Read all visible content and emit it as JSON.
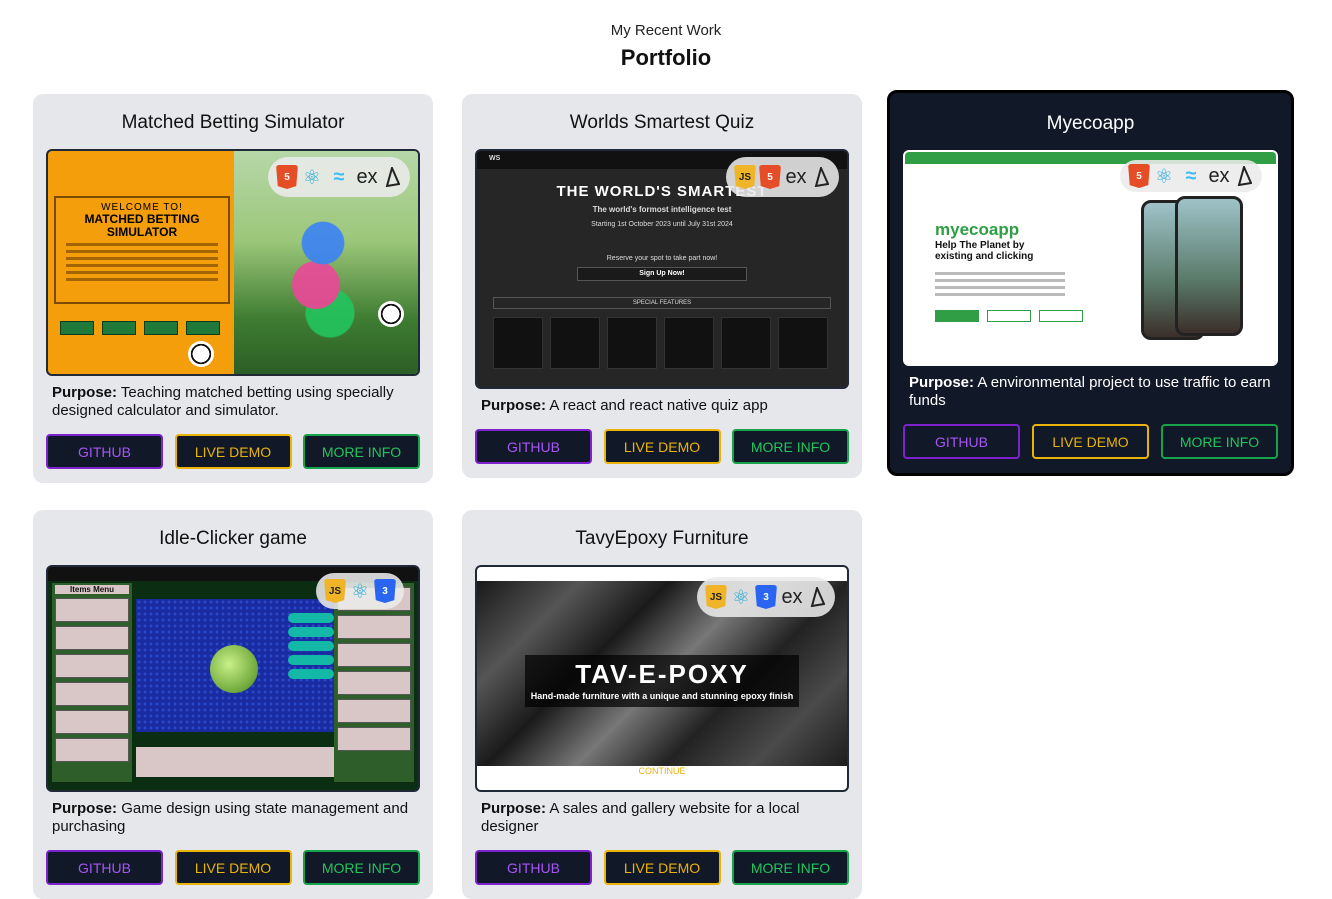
{
  "header": {
    "subtitle": "My Recent Work",
    "title": "Portfolio"
  },
  "colors": {
    "github": "#a855f7",
    "live_demo": "#eab308",
    "more_info": "#22c55e",
    "card_bg": "#e5e7eb",
    "card_dark_bg": "#111827"
  },
  "cards": [
    {
      "title": "Matched Betting Simulator",
      "purpose_label": "Purpose:",
      "purpose": "Teaching matched betting using specially designed calculator and simulator.",
      "tech_icons": [
        "html5-icon",
        "react-icon",
        "tailwind-icon",
        "express-icon",
        "prisma-icon"
      ],
      "shot": {
        "welcome": "WELCOME TO!",
        "name": "MATCHED BETTING SIMULATOR"
      },
      "github": "GITHUB",
      "live_demo": "LIVE DEMO",
      "more_info": "MORE INFO"
    },
    {
      "title": "Worlds Smartest Quiz",
      "purpose_label": "Purpose:",
      "purpose": "A react and react native quiz app",
      "tech_icons": [
        "javascript-icon",
        "html5-icon",
        "express-icon",
        "prisma-icon"
      ],
      "shot": {
        "logo": "WS",
        "headline": "THE WORLD'S SMARTEST",
        "line1": "The world's formost intelligence test",
        "line2": "Starting 1st October 2023 until July 31st 2024",
        "line3": "Reserve your spot to take part now!",
        "signup": "Sign Up Now!",
        "features": "SPECIAL FEATURES"
      },
      "github": "GITHUB",
      "live_demo": "LIVE DEMO",
      "more_info": "MORE INFO"
    },
    {
      "title": "Myecoapp",
      "purpose_label": "Purpose:",
      "purpose": "A environmental project to use traffic to earn funds",
      "tech_icons": [
        "html5-icon",
        "react-icon",
        "tailwind-icon",
        "express-icon",
        "prisma-icon"
      ],
      "shot": {
        "brand": "myecoapp",
        "tagline": "Help The Planet by existing and clicking"
      },
      "github": "GITHUB",
      "live_demo": "LIVE DEMO",
      "more_info": "MORE INFO"
    },
    {
      "title": "Idle-Clicker game",
      "purpose_label": "Purpose:",
      "purpose": "Game design using state management and purchasing",
      "tech_icons": [
        "javascript-icon",
        "react-icon",
        "css3-icon"
      ],
      "shot": {
        "menu": "Items Menu"
      },
      "github": "GITHUB",
      "live_demo": "LIVE DEMO",
      "more_info": "MORE INFO"
    },
    {
      "title": "TavyEpoxy Furniture",
      "purpose_label": "Purpose:",
      "purpose": "A sales and gallery website for a local designer",
      "tech_icons": [
        "javascript-icon",
        "react-icon",
        "css3-icon",
        "express-icon",
        "prisma-icon"
      ],
      "shot": {
        "name": "TAV-E-POXY",
        "tagline": "Hand-made furniture with a unique and stunning epoxy finish",
        "cta": "CONTINUE"
      },
      "github": "GITHUB",
      "live_demo": "LIVE DEMO",
      "more_info": "MORE INFO"
    }
  ]
}
